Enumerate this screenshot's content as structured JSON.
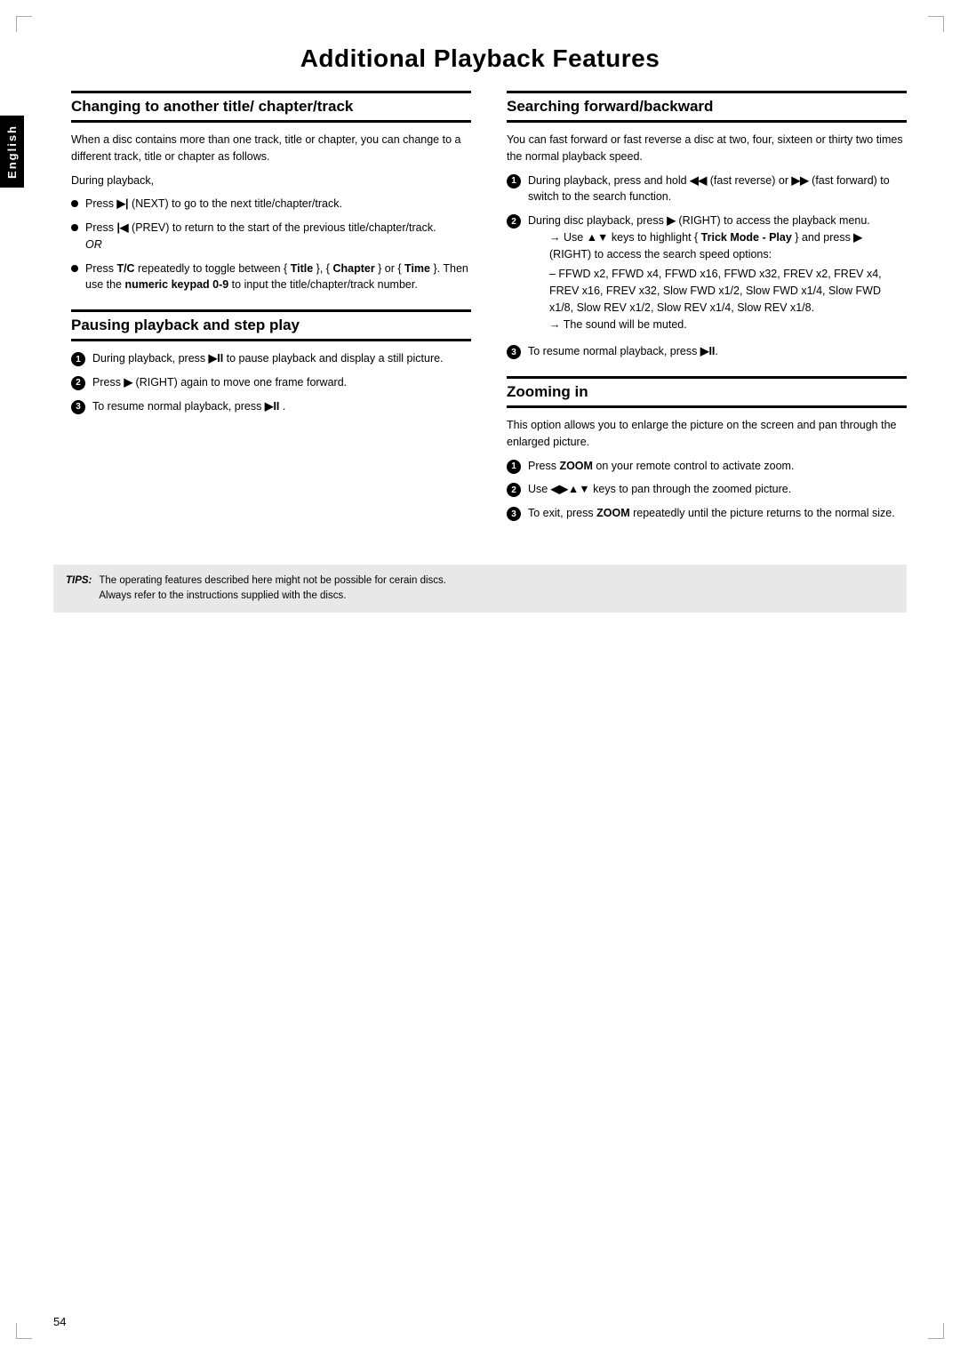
{
  "page": {
    "title": "Additional Playback Features",
    "page_number": "54",
    "english_tab": "English"
  },
  "tips": {
    "label": "TIPS:",
    "text1": "The operating features described here might not be possible for cerain discs.",
    "text2": "Always refer to the instructions supplied with the discs."
  },
  "left_column": {
    "section1": {
      "title": "Changing to another title/ chapter/track",
      "intro": "When a disc contains more than one track, title or chapter, you can change to a different track, title or chapter as follows.",
      "during": "During playback,",
      "bullets": [
        "Press ▶| (NEXT) to go to the next title/chapter/track.",
        "Press |◀ (PREV) to return to the start of the previous title/chapter/track. OR",
        "Press T/C repeatedly to toggle between { Title }, { Chapter } or { Time }. Then use the numeric keypad 0-9 to input the title/chapter/track number."
      ]
    },
    "section2": {
      "title": "Pausing playback and step play",
      "items": [
        "During playback, press ▶II to pause playback and display a still picture.",
        "Press ▶ (RIGHT) again to move one frame forward.",
        "To resume normal playback, press ▶II ."
      ]
    }
  },
  "right_column": {
    "section1": {
      "title": "Searching forward/backward",
      "intro": "You can fast forward or fast reverse a disc at two, four, sixteen or thirty two times the normal playback speed.",
      "items": [
        "During playback, press and hold ◀◀ (fast reverse) or ▶▶ (fast forward) to switch to the search function.",
        "During disc playback, press ▶ (RIGHT) to access the playback menu.",
        "To resume normal playback, press ▶II."
      ],
      "item2_sub": [
        "→ Use ▲▼ keys to highlight { Trick Mode - Play } and press ▶ (RIGHT) to access the search speed options:",
        "– FFWD x2, FFWD x4, FFWD x16, FFWD x32, FREV x2, FREV x4, FREV x16, FREV x32, Slow FWD x1/2, Slow FWD x1/4, Slow FWD x1/8, Slow REV x1/2, Slow REV x1/4, Slow REV x1/8.",
        "→ The sound will be muted."
      ]
    },
    "section2": {
      "title": "Zooming in",
      "intro": "This option allows you to enlarge the picture on the screen and pan through the enlarged picture.",
      "items": [
        "Press ZOOM on your remote control to activate zoom.",
        "Use ◀▶▲▼ keys to pan through the zoomed picture.",
        "To exit, press ZOOM repeatedly until the picture returns to the normal size."
      ]
    }
  }
}
